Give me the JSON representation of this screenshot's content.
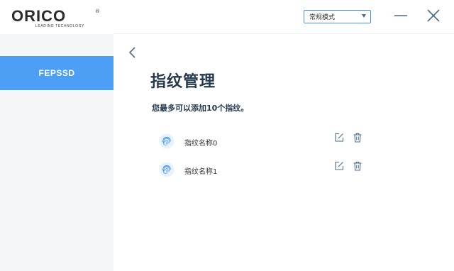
{
  "brand": {
    "name": "ORICO",
    "tagline": "LEADING TECHNOLOGY",
    "mark": "®"
  },
  "mode_select": {
    "value": "常规模式"
  },
  "sidebar": {
    "items": [
      {
        "label": "FEPSSD",
        "active": true
      }
    ]
  },
  "main": {
    "title": "指纹管理",
    "subtitle": "您最多可以添加10个指纹。",
    "fingerprints": [
      {
        "name": "指纹名称0"
      },
      {
        "name": "指纹名称1"
      }
    ]
  },
  "colors": {
    "accent": "#4d9ff5",
    "title": "#253a50",
    "sidebar_bg": "#f5f6f8",
    "icon": "#4d6b8a"
  },
  "icons": [
    "minimize-icon",
    "close-icon",
    "back-arrow-icon",
    "fingerprint-icon",
    "edit-icon",
    "trash-icon"
  ]
}
